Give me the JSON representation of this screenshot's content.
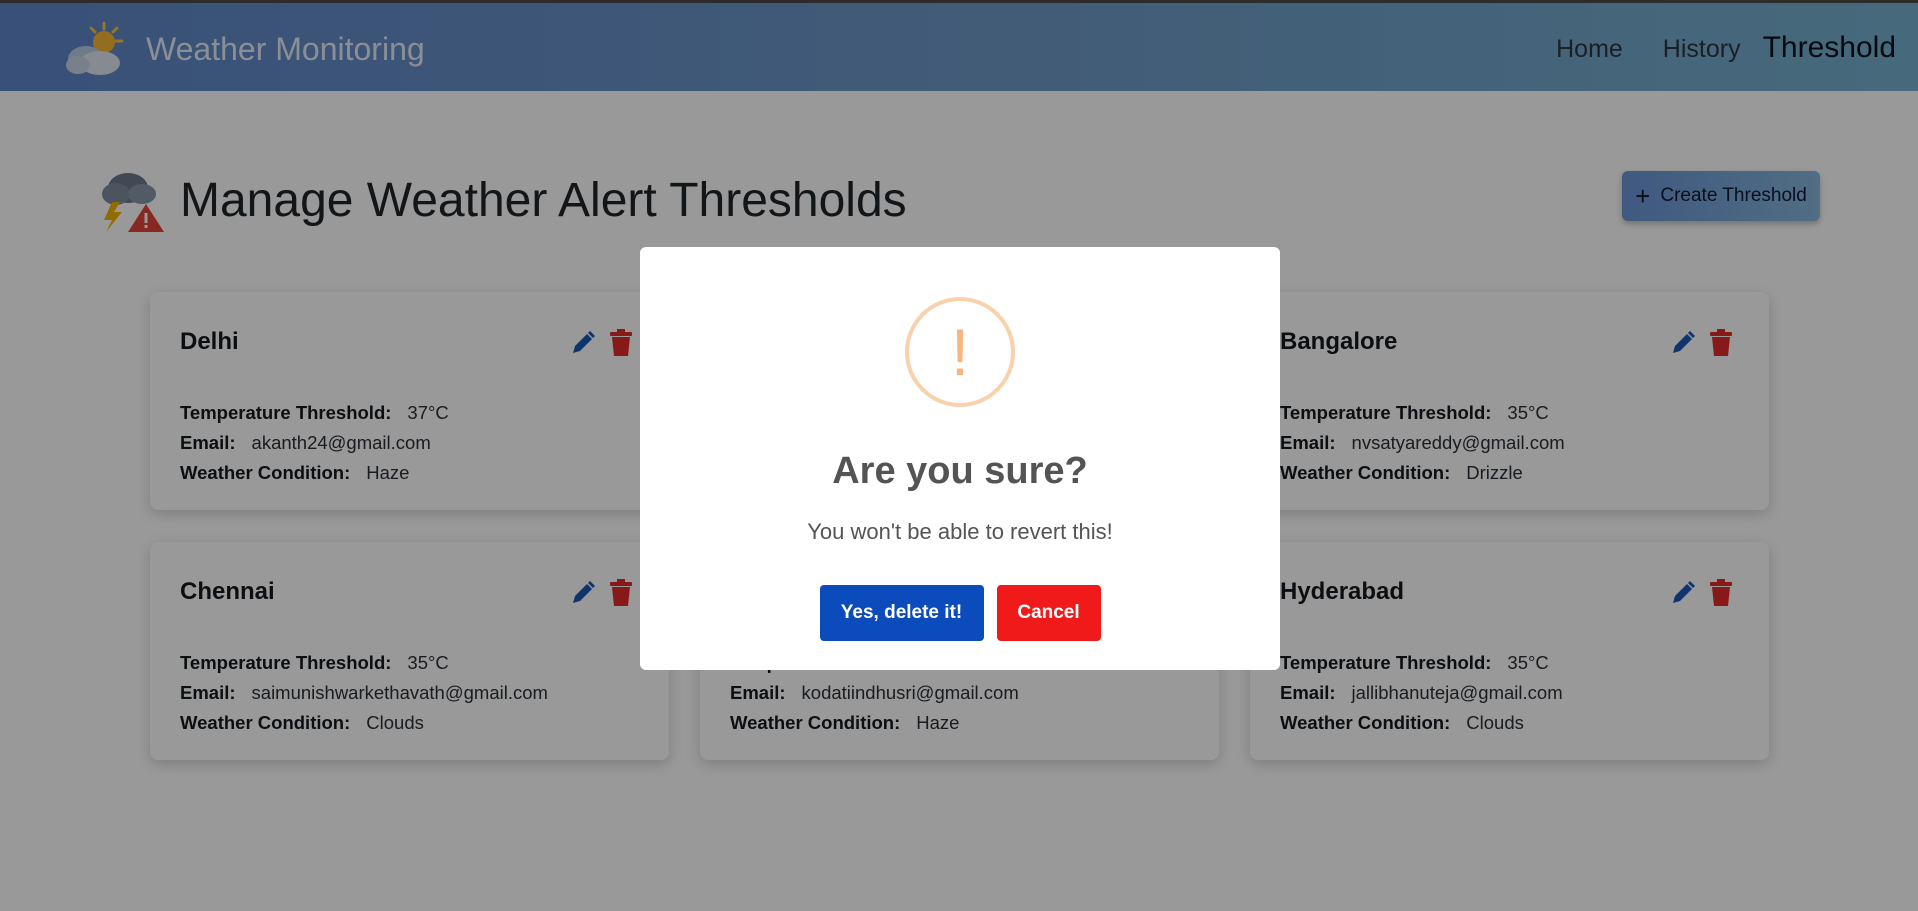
{
  "colors": {
    "navbar_gradient": [
      "#5f86c9",
      "#76b0cf"
    ],
    "confirm_button": "#0c4bbb",
    "cancel_button": "#f01a1a",
    "edit_icon": "#1b57b8",
    "delete_icon": "#e22a2a",
    "warning": "#f8bb86"
  },
  "navbar": {
    "brand_icon": "partly-cloudy-sun-icon",
    "brand_title": "Weather Monitoring",
    "links": [
      {
        "label": "Home",
        "active": false
      },
      {
        "label": "History",
        "active": false
      },
      {
        "label": "Threshold",
        "active": true
      }
    ]
  },
  "header": {
    "icon": "storm-warning-icon",
    "title": "Manage Weather Alert Thresholds",
    "create_button_label": "Create Threshold",
    "create_button_icon": "plus-icon"
  },
  "field_labels": {
    "temperature": "Temperature Threshold:",
    "email": "Email:",
    "condition": "Weather Condition:"
  },
  "cards": [
    {
      "city": "Delhi",
      "temperature": "37°C",
      "email": "akanth24@gmail.com",
      "condition": "Haze"
    },
    {
      "city": "Bangalore",
      "temperature": "35°C",
      "email": "nvsatyareddy@gmail.com",
      "condition": "Drizzle"
    },
    {
      "city": "Chennai",
      "temperature": "35°C",
      "email": "saimunishwarkethavath@gmail.com",
      "condition": "Clouds"
    },
    {
      "city": "",
      "temperature": "",
      "email": "kodatiindhusri@gmail.com",
      "condition": "Haze"
    },
    {
      "city": "Hyderabad",
      "temperature": "35°C",
      "email": "jallibhanuteja@gmail.com",
      "condition": "Clouds"
    }
  ],
  "modal": {
    "icon": "warning-exclamation-icon",
    "icon_glyph": "!",
    "title": "Are you sure?",
    "text": "You won't be able to revert this!",
    "confirm_label": "Yes, delete it!",
    "cancel_label": "Cancel"
  }
}
